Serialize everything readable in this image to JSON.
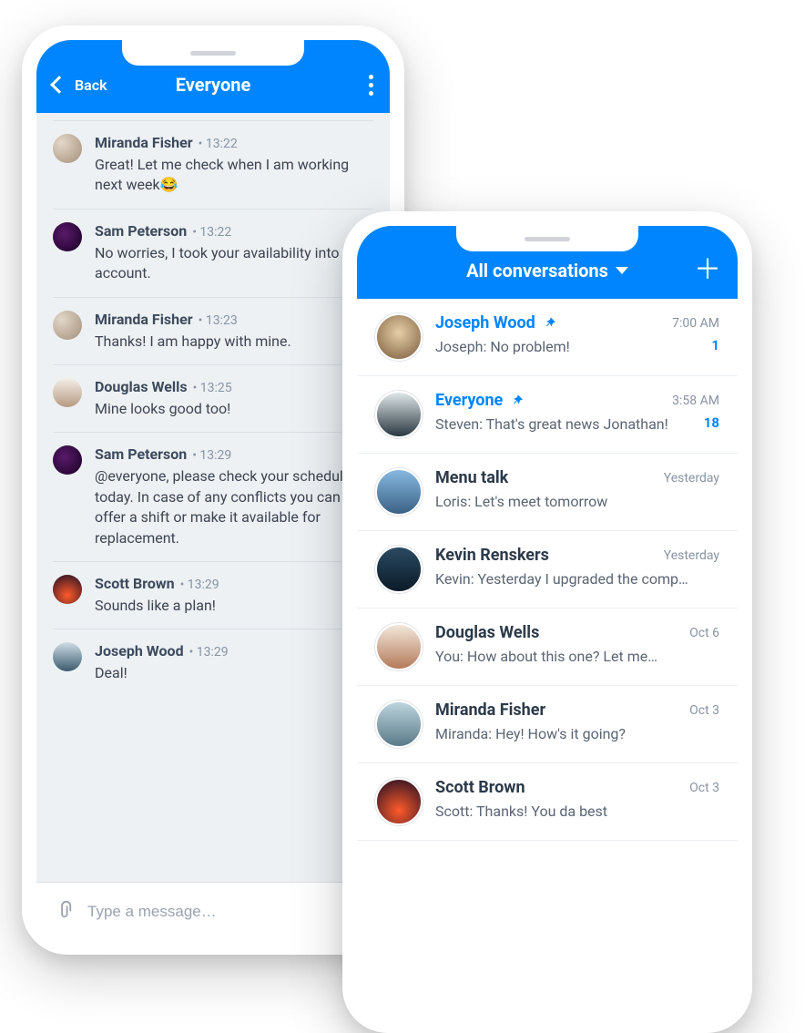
{
  "chat": {
    "back_label": "Back",
    "title": "Everyone",
    "composer_placeholder": "Type a message…",
    "messages": [
      {
        "name": "Miranda Fisher",
        "time": "• 13:22",
        "text": "Great! Let me check when I am working next week😂",
        "avatar_bg": "radial-gradient(circle at 30% 30%,#e3d7c9,#a38f7a)"
      },
      {
        "name": "Sam Peterson",
        "time": "• 13:22",
        "text": "No worries, I took your availability into account.",
        "avatar_bg": "radial-gradient(circle at 40% 40%,#5a1a6a,#160023)"
      },
      {
        "name": "Miranda Fisher",
        "time": "• 13:23",
        "text": "Thanks! I am happy with mine.",
        "avatar_bg": "radial-gradient(circle at 30% 30%,#e3d7c9,#a38f7a)"
      },
      {
        "name": "Douglas Wells",
        "time": "• 13:25",
        "text": "Mine looks good too!",
        "avatar_bg": "linear-gradient(#f4efe8,#b59a82)"
      },
      {
        "name": "Sam Peterson",
        "time": "• 13:29",
        "text": "@everyone, please check your schedule today. In case of any conflicts you can offer a shift or make it available for replacement.",
        "avatar_bg": "radial-gradient(circle at 40% 40%,#5a1a6a,#160023)"
      },
      {
        "name": "Scott Brown",
        "time": "• 13:29",
        "text": "Sounds like a plan!",
        "avatar_bg": "radial-gradient(circle at 50% 70%,#ff5a2a,#1a0d24)"
      },
      {
        "name": "Joseph Wood",
        "time": "• 13:29",
        "text": "Deal!",
        "avatar_bg": "linear-gradient(#d0dee6,#3a5a6e)"
      }
    ]
  },
  "list": {
    "title": "All conversations",
    "items": [
      {
        "name": "Joseph Wood",
        "pinned": true,
        "time": "7:00 AM",
        "sub": "Joseph: No problem!",
        "badge": "1",
        "avatar_bg": "radial-gradient(circle at 50% 40%,#e6cfa8,#7a5a3a)",
        "ring": false
      },
      {
        "name": "Everyone",
        "pinned": true,
        "time": "3:58 AM",
        "sub": "Steven: That's great news Jonathan!",
        "badge": "18",
        "avatar_bg": "linear-gradient(#dfe7ea,#2b3840)",
        "ring": true
      },
      {
        "name": "Menu talk",
        "pinned": false,
        "time": "Yesterday",
        "sub": "Loris: Let's meet tomorrow",
        "badge": "",
        "avatar_bg": "linear-gradient(#87b8e0,#3a6285)",
        "ring": true
      },
      {
        "name": "Kevin Renskers",
        "pinned": false,
        "time": "Yesterday",
        "sub": "Kevin: Yesterday I upgraded the comp…",
        "badge": "",
        "avatar_bg": "linear-gradient(#2a4a62,#0b1b28)",
        "ring": false
      },
      {
        "name": "Douglas Wells",
        "pinned": false,
        "time": "Oct 6",
        "sub": "You: How about this one? Let me…",
        "badge": "",
        "avatar_bg": "linear-gradient(#f2e8dc,#b57a5a)",
        "ring": false
      },
      {
        "name": "Miranda Fisher",
        "pinned": false,
        "time": "Oct 3",
        "sub": "Miranda: Hey! How's it going?",
        "badge": "",
        "avatar_bg": "linear-gradient(#bcd4de,#5a7a88)",
        "ring": false
      },
      {
        "name": "Scott Brown",
        "pinned": false,
        "time": "Oct 3",
        "sub": "Scott: Thanks! You da best",
        "badge": "",
        "avatar_bg": "radial-gradient(circle at 50% 70%,#ff5a2a,#1a0d24)",
        "ring": false
      }
    ]
  }
}
